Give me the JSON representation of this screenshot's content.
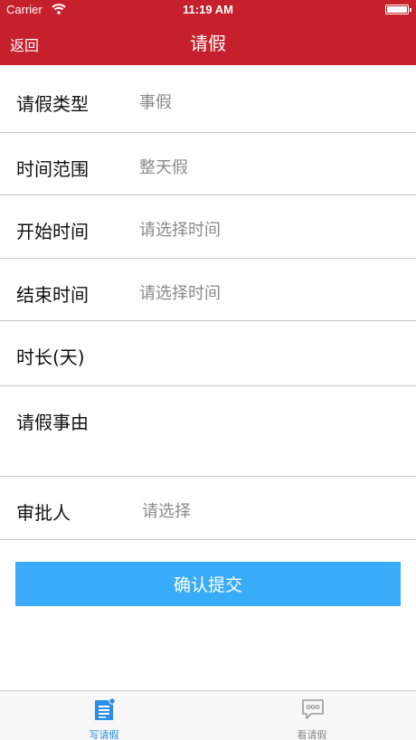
{
  "status_bar": {
    "carrier": "Carrier",
    "time": "11:19 AM",
    "battery_level": 1.0
  },
  "nav": {
    "back_label": "返回",
    "title": "请假"
  },
  "form": {
    "rows": [
      {
        "label": "请假类型",
        "value": "事假"
      },
      {
        "label": "时间范围",
        "value": "整天假"
      },
      {
        "label": "开始时间",
        "value": "请选择时间"
      },
      {
        "label": "结束时间",
        "value": "请选择时间"
      },
      {
        "label": "时长(天)"
      },
      {
        "label": "请假事由"
      },
      {
        "label": "审批人",
        "value": "请选择"
      }
    ],
    "submit_label": "确认提交"
  },
  "tabbar": {
    "tabs": [
      {
        "label": "写请假",
        "icon": "write-document-icon",
        "selected": true
      },
      {
        "label": "看请假",
        "icon": "chat-bubble-icon",
        "selected": false
      }
    ]
  },
  "colors": {
    "nav_background": "#c5202c",
    "submit_background": "#3aabf8",
    "tab_selected": "#2a8ee8",
    "tab_unselected": "#8a8a8a"
  }
}
